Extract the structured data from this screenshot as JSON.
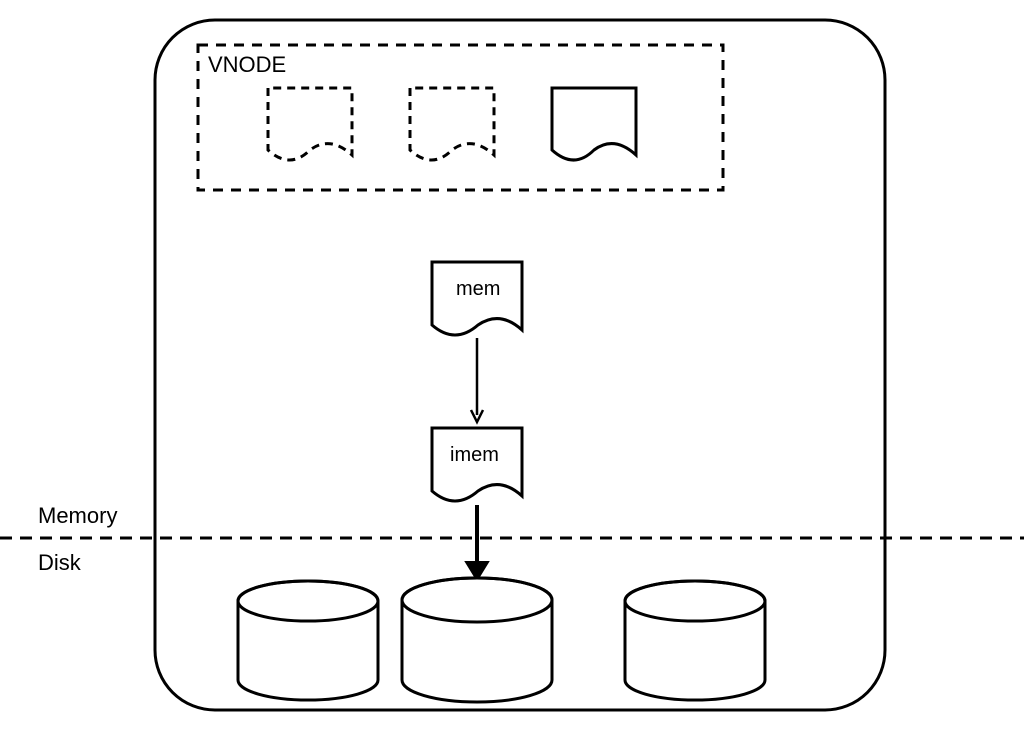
{
  "labels": {
    "vnode": "VNODE",
    "mem": "mem",
    "imem": "imem",
    "memory": "Memory",
    "disk": "Disk"
  }
}
